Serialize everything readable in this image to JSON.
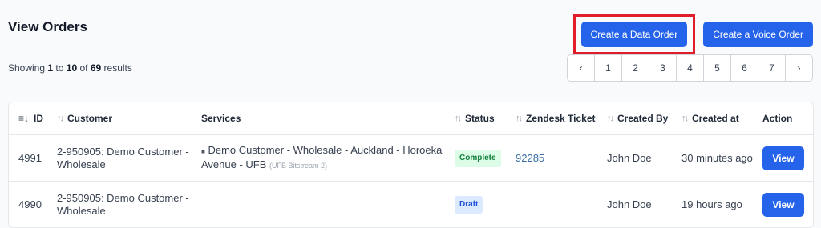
{
  "page": {
    "title": "View Orders"
  },
  "actions": {
    "create_data_order": "Create a Data Order",
    "create_voice_order": "Create a Voice Order"
  },
  "results": {
    "prefix": "Showing",
    "from": "1",
    "to_word": "to",
    "to": "10",
    "of_word": "of",
    "total": "69",
    "suffix": "results"
  },
  "pagination": {
    "prev_icon": "chevron-left-icon",
    "next_icon": "chevron-right-icon",
    "prev": "‹",
    "next": "›",
    "pages": [
      "1",
      "2",
      "3",
      "4",
      "5",
      "6",
      "7"
    ]
  },
  "table": {
    "headers": {
      "id": "ID",
      "customer": "Customer",
      "services": "Services",
      "status": "Status",
      "zendesk_ticket": "Zendesk Ticket",
      "created_by": "Created By",
      "created_at": "Created at",
      "action": "Action"
    },
    "rows": [
      {
        "id": "4991",
        "customer": "2-950905: Demo Customer - Wholesale",
        "service": "Demo Customer - Wholesale - Auckland - Horoeka Avenue - UFB",
        "service_sub": "(UFB Bitstream 2)",
        "status": "Complete",
        "ticket": "92285",
        "created_by": "John Doe",
        "created_at": "30 minutes ago",
        "action": "View"
      },
      {
        "id": "4990",
        "customer": "2-950905: Demo Customer - Wholesale",
        "service": "",
        "service_sub": "",
        "status": "Draft",
        "ticket": "",
        "created_by": "John Doe",
        "created_at": "19 hours ago",
        "action": "View"
      }
    ]
  },
  "colors": {
    "primary": "#2563eb",
    "highlight": "#e11d2a",
    "complete_bg": "#dcfce7",
    "complete_text": "#15803d",
    "draft_bg": "#dbeafe",
    "draft_text": "#1d4ed8",
    "link": "#3b6fa5"
  }
}
